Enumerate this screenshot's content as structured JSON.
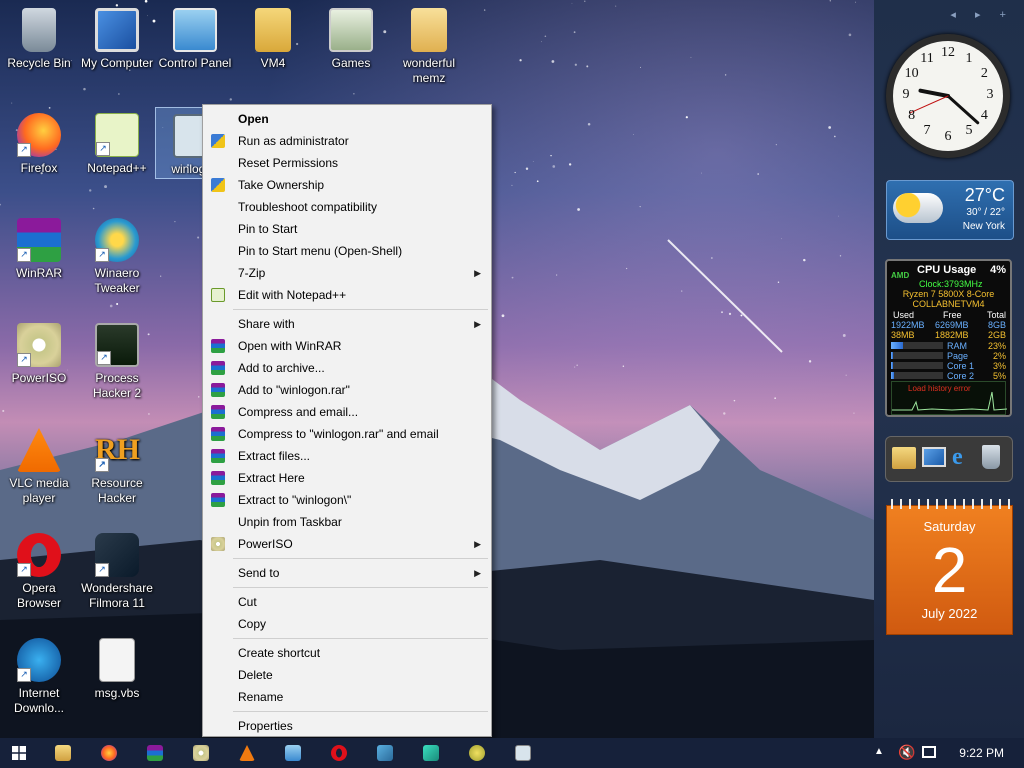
{
  "desktop": {
    "icons": [
      {
        "label": "Recycle Bin",
        "icon": "recycle-bin-icon"
      },
      {
        "label": "My Computer",
        "icon": "computer-icon"
      },
      {
        "label": "Control Panel",
        "icon": "control-panel-icon"
      },
      {
        "label": "VM4",
        "icon": "user-folder-icon"
      },
      {
        "label": "Games",
        "icon": "games-icon"
      },
      {
        "label": "wonderful memz",
        "icon": "folder-icon"
      },
      {
        "label": "Firefox",
        "icon": "firefox-icon"
      },
      {
        "label": "Notepad++",
        "icon": "notepadpp-icon"
      },
      {
        "label": "winlogon",
        "icon": "app-icon"
      },
      {
        "label": "WinRAR",
        "icon": "winrar-icon"
      },
      {
        "label": "Winaero Tweaker",
        "icon": "winaero-icon"
      },
      {
        "label": "PowerISO",
        "icon": "poweriso-icon"
      },
      {
        "label": "Process Hacker 2",
        "icon": "process-hacker-icon"
      },
      {
        "label": "VLC media player",
        "icon": "vlc-icon"
      },
      {
        "label": "Resource Hacker",
        "icon": "resource-hacker-icon"
      },
      {
        "label": "Opera Browser",
        "icon": "opera-icon"
      },
      {
        "label": "Wondershare Filmora 11",
        "icon": "filmora-icon"
      },
      {
        "label": "Internet Downlo...",
        "icon": "idm-icon"
      },
      {
        "label": "msg.vbs",
        "icon": "script-icon"
      }
    ]
  },
  "context_menu": {
    "items": [
      {
        "label": "Open",
        "bold": true
      },
      {
        "label": "Run as administrator",
        "icon": "shield-icon"
      },
      {
        "label": "Reset Permissions"
      },
      {
        "label": "Take Ownership",
        "icon": "shield-icon"
      },
      {
        "label": "Troubleshoot compatibility"
      },
      {
        "label": "Pin to Start"
      },
      {
        "label": "Pin to Start menu (Open-Shell)"
      },
      {
        "label": "7-Zip",
        "submenu": true
      },
      {
        "label": "Edit with Notepad++",
        "icon": "notepadpp-icon"
      },
      {
        "label": "Share with",
        "submenu": true
      },
      {
        "label": "Open with WinRAR",
        "icon": "winrar-icon"
      },
      {
        "label": "Add to archive...",
        "icon": "winrar-icon"
      },
      {
        "label": "Add to \"winlogon.rar\"",
        "icon": "winrar-icon"
      },
      {
        "label": "Compress and email...",
        "icon": "winrar-icon"
      },
      {
        "label": "Compress to \"winlogon.rar\" and email",
        "icon": "winrar-icon"
      },
      {
        "label": "Extract files...",
        "icon": "winrar-icon"
      },
      {
        "label": "Extract Here",
        "icon": "winrar-icon"
      },
      {
        "label": "Extract to \"winlogon\\\"",
        "icon": "winrar-icon"
      },
      {
        "label": "Unpin from Taskbar"
      },
      {
        "label": "PowerISO",
        "icon": "poweriso-icon",
        "submenu": true
      },
      {
        "label": "Send to",
        "submenu": true
      },
      {
        "label": "Cut"
      },
      {
        "label": "Copy"
      },
      {
        "label": "Create shortcut"
      },
      {
        "label": "Delete"
      },
      {
        "label": "Rename"
      },
      {
        "label": "Properties"
      }
    ]
  },
  "sidebar": {
    "clock": {
      "hour": 9,
      "minute": 22,
      "second": 41
    },
    "weather": {
      "temp": "27°C",
      "range": "30° / 22°",
      "city": "New York"
    },
    "cpu": {
      "title": "CPU Usage",
      "percent": "4%",
      "brand": "AMD",
      "clock": "Clock:3793MHz",
      "model": "Ryzen 7 5800X 8-Core",
      "host": "COLLABNETVM4",
      "headers": [
        "Used",
        "Free",
        "Total"
      ],
      "rows": [
        [
          "1922MB",
          "6269MB",
          "8GB"
        ],
        [
          "38MB",
          "1882MB",
          "2GB"
        ]
      ],
      "meters": [
        {
          "label": "RAM",
          "value": "23%",
          "fill": 0.23
        },
        {
          "label": "Page",
          "value": "2%",
          "fill": 0.02
        },
        {
          "label": "Core 1",
          "value": "3%",
          "fill": 0.03
        },
        {
          "label": "Core 2",
          "value": "5%",
          "fill": 0.05
        }
      ],
      "graph_note": "Load history error"
    },
    "calendar": {
      "weekday": "Saturday",
      "day": "2",
      "month_year": "July 2022"
    }
  },
  "taskbar": {
    "items": [
      "start-icon",
      "explorer-icon",
      "firefox-icon",
      "winrar-icon",
      "poweriso-icon",
      "vlc-icon",
      "control-panel-icon",
      "opera-icon",
      "process-hacker-icon",
      "filmora-icon",
      "idm-icon",
      "app-icon"
    ],
    "time": "9:22 PM"
  },
  "colors": {
    "menu_bg": "#f2f2f2",
    "taskbar_bg": "#16213a",
    "calendar_orange": "#e8701a"
  }
}
